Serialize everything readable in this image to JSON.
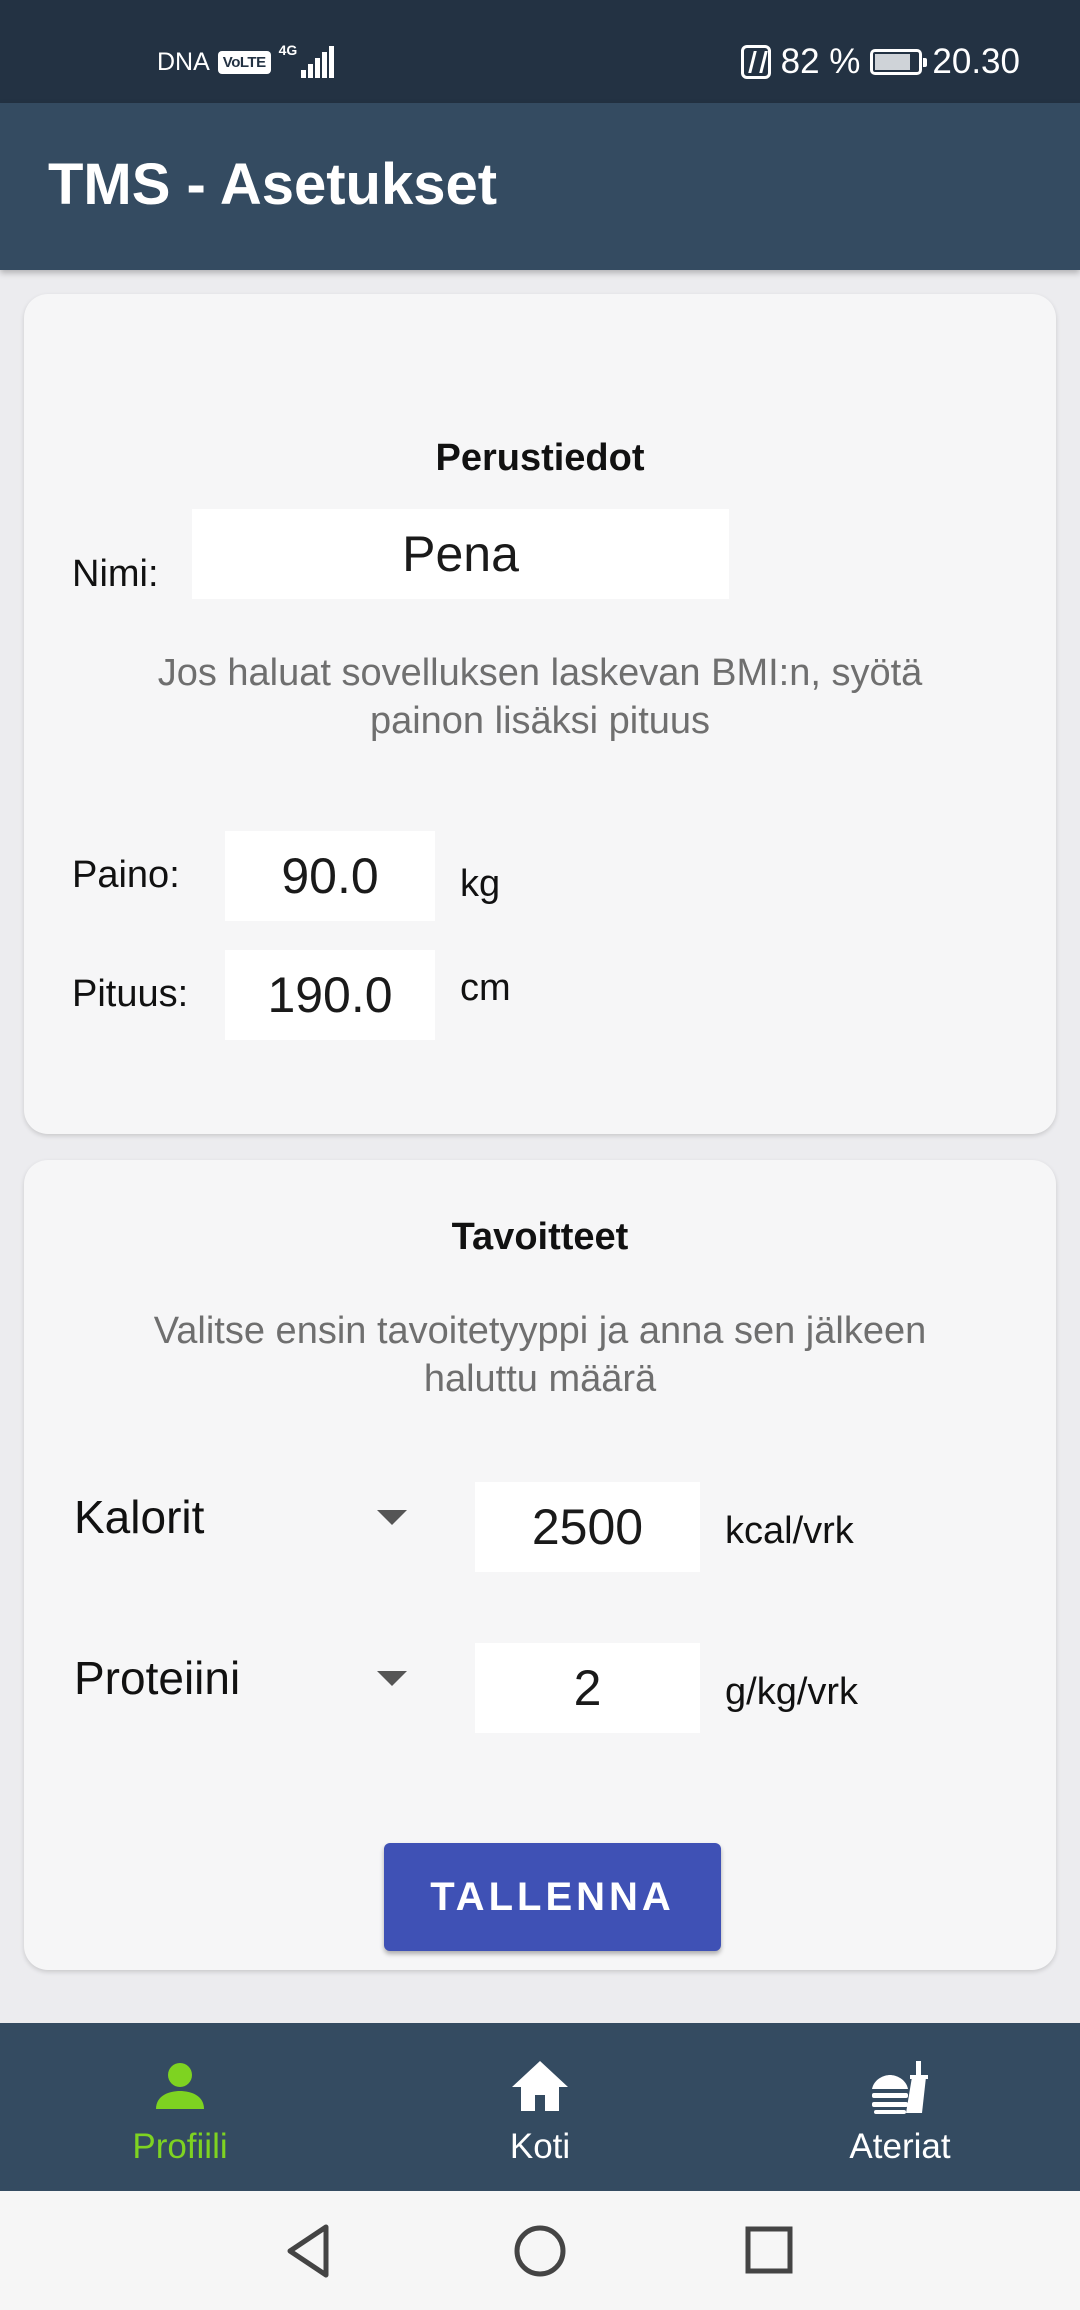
{
  "status_bar": {
    "carrier": "DNA",
    "volte": "VoLTE",
    "network": "4G",
    "battery_percent": "82 %",
    "time": "20.30"
  },
  "app_bar": {
    "title": "TMS - Asetukset"
  },
  "basic_info": {
    "heading": "Perustiedot",
    "name_label": "Nimi:",
    "name_value": "Pena",
    "bmi_hint": "Jos haluat sovelluksen laskevan BMI:n, syötä painon lisäksi pituus",
    "weight_label": "Paino:",
    "weight_value": "90.0",
    "weight_unit": "kg",
    "height_label": "Pituus:",
    "height_value": "190.0",
    "height_unit": "cm"
  },
  "goals": {
    "heading": "Tavoitteet",
    "hint": "Valitse ensin tavoitetyyppi ja anna sen jälkeen haluttu määrä",
    "rows": [
      {
        "type": "Kalorit",
        "value": "2500",
        "unit": "kcal/vrk"
      },
      {
        "type": "Proteiini",
        "value": "2",
        "unit": "g/kg/vrk"
      }
    ],
    "save_label": "TALLENNA"
  },
  "bottom_nav": {
    "items": [
      {
        "label": "Profiili",
        "icon": "person-icon",
        "active": true
      },
      {
        "label": "Koti",
        "icon": "home-icon",
        "active": false
      },
      {
        "label": "Ateriat",
        "icon": "fastfood-icon",
        "active": false
      }
    ]
  },
  "colors": {
    "status_bar": "#233243",
    "app_bar": "#344b61",
    "accent_button": "#3f51b5",
    "active_nav": "#7ed321",
    "card_background": "#f6f6f7",
    "page_background": "#ececef"
  }
}
